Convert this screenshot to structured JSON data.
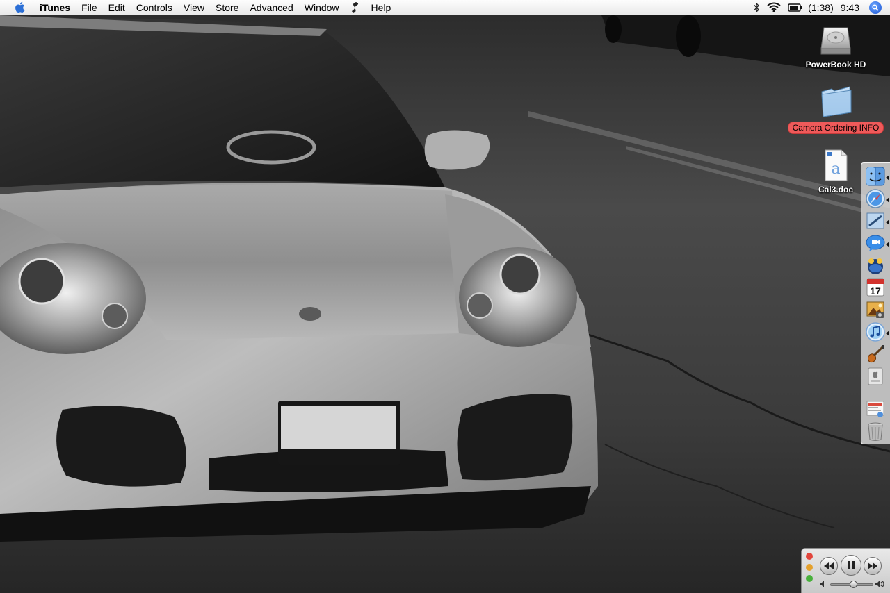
{
  "menubar": {
    "app_name": "iTunes",
    "menus": [
      "File",
      "Edit",
      "Controls",
      "View",
      "Store",
      "Advanced",
      "Window",
      "Help"
    ],
    "battery_time": "(1:38)",
    "clock": "9:43",
    "icons": {
      "apple": "apple-menu-icon",
      "script": "script-menu-icon",
      "bluetooth": "bluetooth-icon",
      "wifi": "wifi-icon",
      "battery": "battery-icon",
      "spotlight": "spotlight-search-icon"
    }
  },
  "desktop": {
    "items": [
      {
        "label": "PowerBook HD",
        "icon": "hard-drive-icon",
        "selected": false
      },
      {
        "label": "Camera Ordering INFO",
        "icon": "folder-icon",
        "selected": true,
        "label_color": "#ef5a5a"
      },
      {
        "label": "Cal3.doc",
        "icon": "document-icon",
        "selected": false
      }
    ]
  },
  "dock": {
    "items": [
      {
        "name": "Finder",
        "icon": "finder-icon",
        "running": true
      },
      {
        "name": "Safari",
        "icon": "safari-icon",
        "running": true
      },
      {
        "name": "Mail",
        "icon": "mail-icon",
        "running": true
      },
      {
        "name": "iChat",
        "icon": "ichat-icon",
        "running": true
      },
      {
        "name": "Dashboard",
        "icon": "dashboard-icon",
        "running": false
      },
      {
        "name": "iCal",
        "icon": "ical-icon",
        "running": false,
        "date": "17"
      },
      {
        "name": "iPhoto",
        "icon": "iphoto-icon",
        "running": false
      },
      {
        "name": "iTunes",
        "icon": "itunes-icon",
        "running": true
      },
      {
        "name": "GarageBand",
        "icon": "garageband-icon",
        "running": false
      },
      {
        "name": "System Preferences",
        "icon": "system-preferences-icon",
        "running": false
      },
      {
        "name": "Document",
        "icon": "document-stack-icon",
        "running": false
      },
      {
        "name": "Trash",
        "icon": "trash-icon",
        "running": false
      }
    ]
  },
  "mini_player": {
    "icons": [
      "rewind-icon",
      "pause-icon",
      "fast-forward-icon",
      "volume-low-icon",
      "volume-high-icon"
    ],
    "volume": 0.55,
    "traffic_lights": [
      "#e2453c",
      "#e5a12c",
      "#48b03b"
    ]
  }
}
